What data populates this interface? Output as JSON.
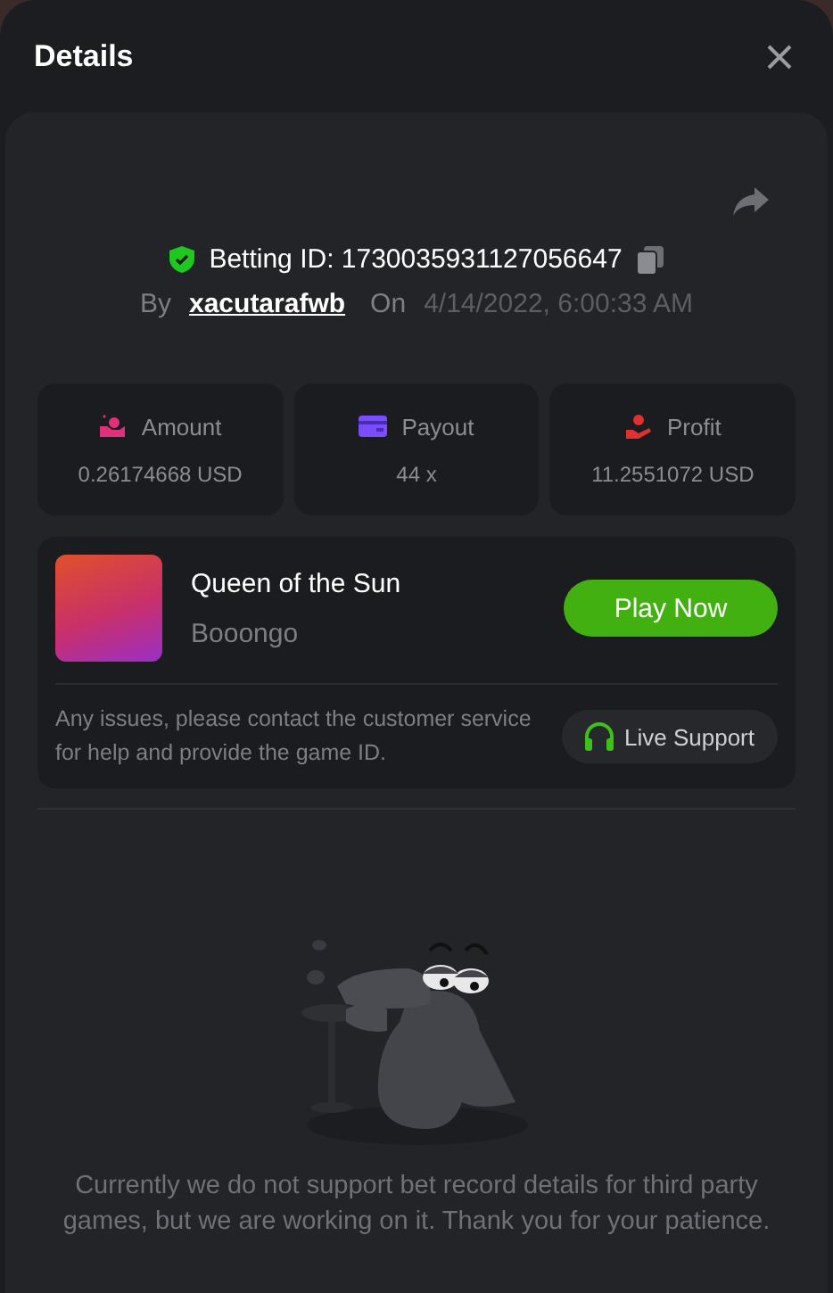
{
  "header": {
    "title": "Details"
  },
  "bet": {
    "id_label": "Betting ID: 1730035931127056647",
    "by_label": "By",
    "user": "xacutarafwb",
    "on_label": "On",
    "date": "4/14/2022, 6:00:33 AM"
  },
  "stats": [
    {
      "kind": "amount",
      "label": "Amount",
      "value": "0.26174668 USD"
    },
    {
      "kind": "payout",
      "label": "Payout",
      "value": "44 x"
    },
    {
      "kind": "profit",
      "label": "Profit",
      "value": "11.2551072 USD"
    }
  ],
  "game": {
    "name": "Queen of the Sun",
    "provider": "Booongo",
    "play_button": "Play Now",
    "notice": "Any issues, please contact the customer service for help and provide the game ID.",
    "support_button": "Live Support"
  },
  "empty_message": "Currently we do not support bet record details for third party games, but we are working on it. Thank you for your patience."
}
